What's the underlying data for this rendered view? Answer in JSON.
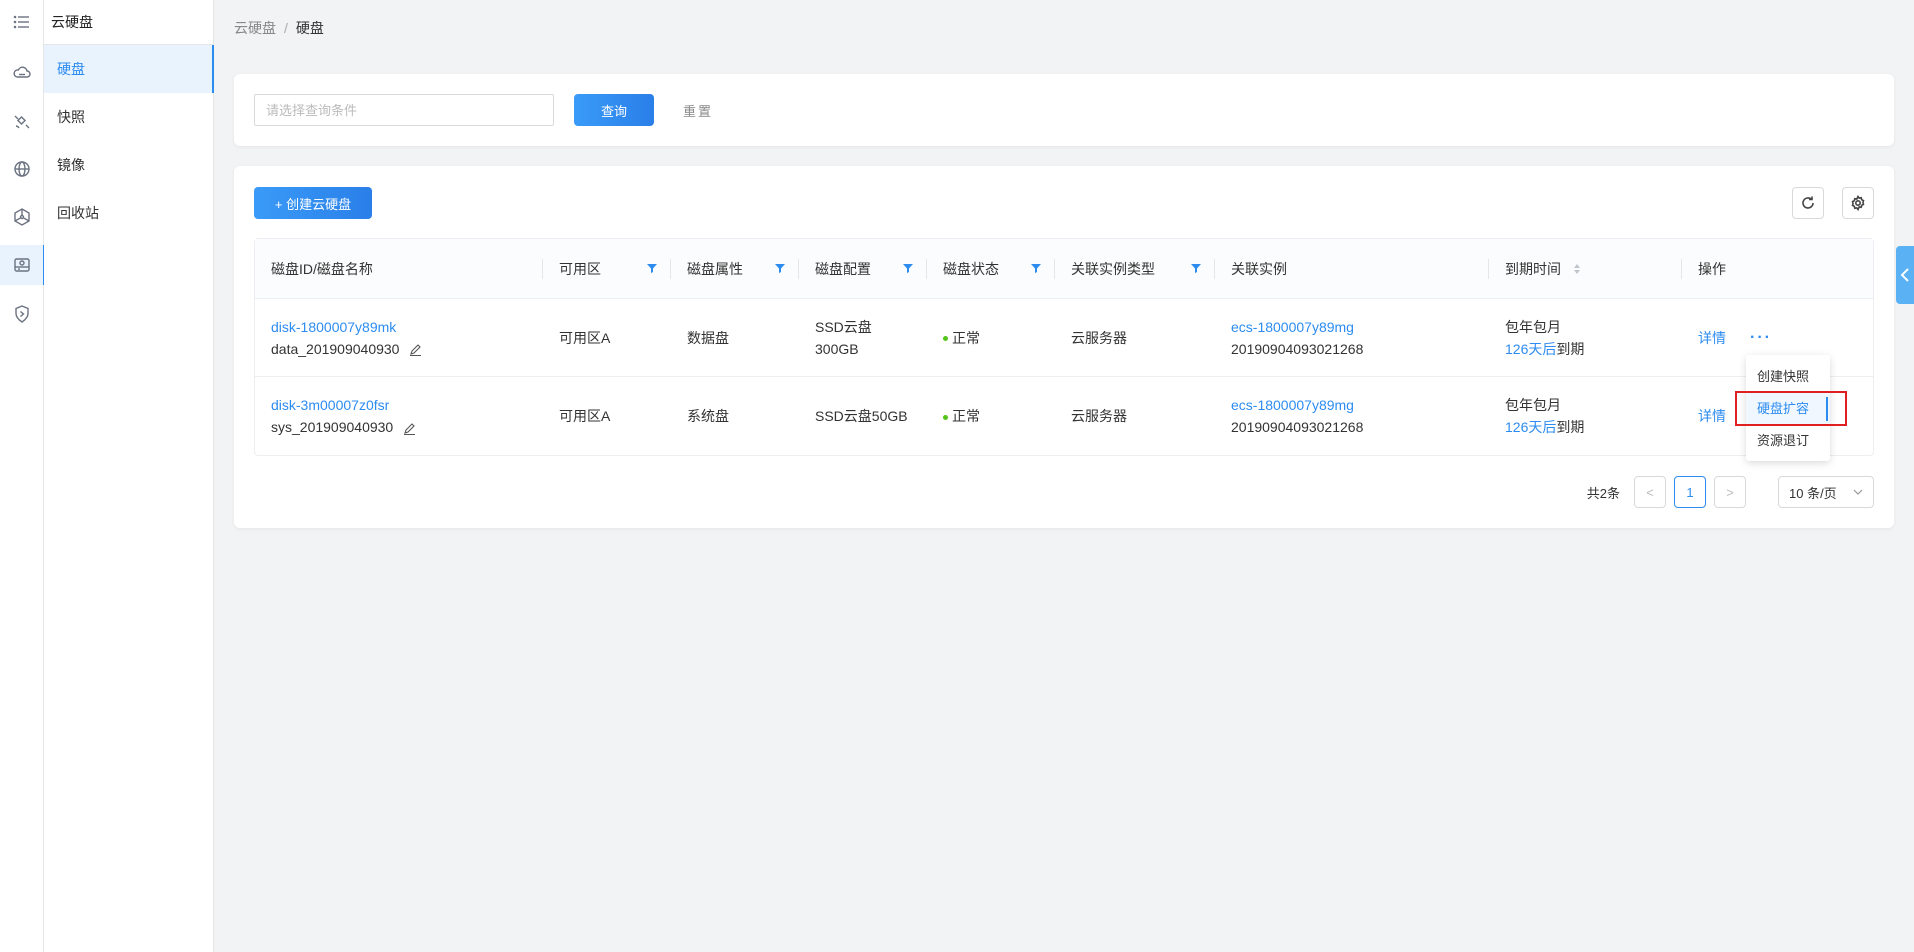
{
  "rail": {
    "icons": [
      "menu-icon",
      "cloud-server-icon",
      "satellite-icon",
      "globe-icon",
      "network-icon",
      "disk-icon",
      "shield-icon"
    ]
  },
  "sidebar": {
    "title": "云硬盘",
    "items": [
      {
        "label": "硬盘",
        "active": true
      },
      {
        "label": "快照",
        "active": false
      },
      {
        "label": "镜像",
        "active": false
      },
      {
        "label": "回收站",
        "active": false
      }
    ]
  },
  "breadcrumb": {
    "parent": "云硬盘",
    "separator": "/",
    "current": "硬盘"
  },
  "search": {
    "placeholder": "请选择查询条件",
    "query_label": "查询",
    "reset_label": "重置"
  },
  "toolbar": {
    "create_label": "+ 创建云硬盘"
  },
  "table": {
    "columns": [
      "磁盘ID/磁盘名称",
      "可用区",
      "磁盘属性",
      "磁盘配置",
      "磁盘状态",
      "关联实例类型",
      "关联实例",
      "到期时间",
      "操作"
    ],
    "rows": [
      {
        "disk_id": "disk-1800007y89mk",
        "disk_name": "data_201909040930",
        "zone": "可用区A",
        "attr": "数据盘",
        "config_line1": "SSD云盘",
        "config_line2": "300GB",
        "status": "正常",
        "instance_type": "云服务器",
        "instance_id": "ecs-1800007y89mg",
        "instance_num": "20190904093021268",
        "expire_plan": "包年包月",
        "expire_days": "126天后",
        "expire_suffix": "到期",
        "detail_label": "详情",
        "more_label": "···"
      },
      {
        "disk_id": "disk-3m00007z0fsr",
        "disk_name": "sys_201909040930",
        "zone": "可用区A",
        "attr": "系统盘",
        "config_line1": "SSD云盘50GB",
        "config_line2": "",
        "status": "正常",
        "instance_type": "云服务器",
        "instance_id": "ecs-1800007y89mg",
        "instance_num": "20190904093021268",
        "expire_plan": "包年包月",
        "expire_days": "126天后",
        "expire_suffix": "到期",
        "detail_label": "详情",
        "more_label": ""
      }
    ]
  },
  "dropdown": {
    "items": [
      "创建快照",
      "硬盘扩容",
      "资源退订"
    ],
    "highlighted": "硬盘扩容"
  },
  "pagination": {
    "total": "共2条",
    "prev": "<",
    "current_page": "1",
    "next": ">",
    "page_size": "10 条/页"
  },
  "colors": {
    "accent": "#2d8cf0",
    "status_ok": "#52c41a",
    "highlight_box": "#e02020",
    "bg": "#f2f3f5"
  }
}
